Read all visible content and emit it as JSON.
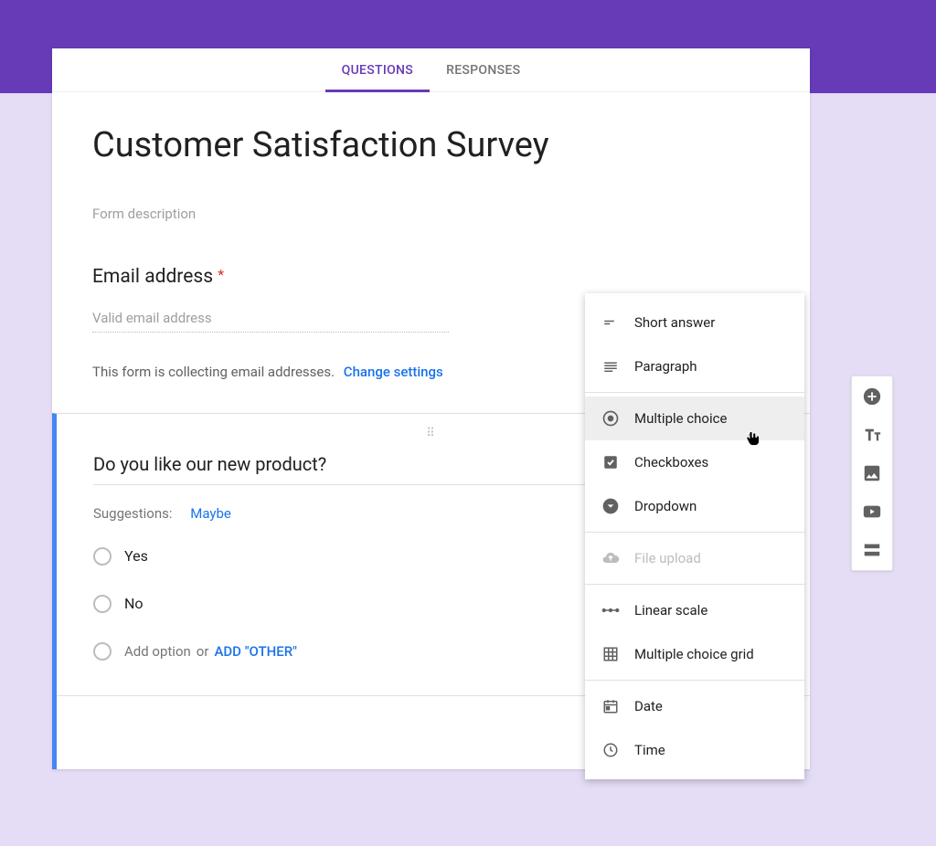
{
  "tabs": {
    "questions": "QUESTIONS",
    "responses": "RESPONSES"
  },
  "form": {
    "title": "Customer Satisfaction Survey",
    "description_placeholder": "Form description",
    "email_label": "Email address",
    "email_placeholder": "Valid email address",
    "collecting_note": "This form is collecting email addresses.",
    "change_settings": "Change settings"
  },
  "question": {
    "title": "Do you like our new product?",
    "suggestions_label": "Suggestions:",
    "suggestion": "Maybe",
    "options": [
      "Yes",
      "No"
    ],
    "add_option": "Add option",
    "or_text": "or",
    "add_other": "ADD \"OTHER\""
  },
  "menu": {
    "short_answer": "Short answer",
    "paragraph": "Paragraph",
    "multiple_choice": "Multiple choice",
    "checkboxes": "Checkboxes",
    "dropdown": "Dropdown",
    "file_upload": "File upload",
    "linear_scale": "Linear scale",
    "mc_grid": "Multiple choice grid",
    "date": "Date",
    "time": "Time"
  },
  "colors": {
    "accent": "#673ab7",
    "link": "#1a73e8",
    "active_border": "#4285f4"
  }
}
